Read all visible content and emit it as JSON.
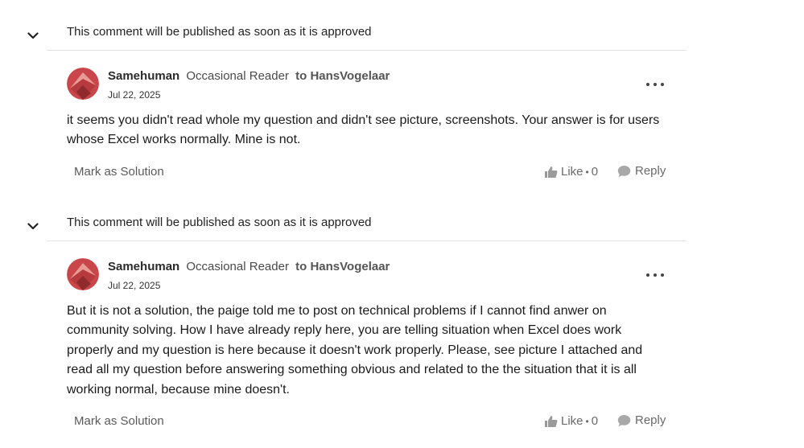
{
  "comments": [
    {
      "pending_note": "This comment will be published as soon as it is approved",
      "author": "Samehuman",
      "rank": "Occasional Reader",
      "to_word": "to",
      "to_user": "HansVogelaar",
      "date": "Jul 22, 2025",
      "body": "it seems you didn't read whole my question and didn't see picture, screenshots. Your answer is for users whose Excel works normally. Mine is not.",
      "mark_solution": "Mark as Solution",
      "like_label": "Like",
      "like_sep": "•",
      "like_count": "0",
      "reply_label": "Reply"
    },
    {
      "pending_note": "This comment will be published as soon as it is approved",
      "author": "Samehuman",
      "rank": "Occasional Reader",
      "to_word": "to",
      "to_user": "HansVogelaar",
      "date": "Jul 22, 2025",
      "body": "But it is not a solution, the paige told me to post on technical problems if I cannot find anwer on community solving. How I have already reply here, you are telling situation when Excel does work properly and my question is here because it doesn't work properly. Please, see picture I attached and read all my question before answering something obvious and related to the the situation that it is all working normal, because mine doesn't.",
      "mark_solution": "Mark as Solution",
      "like_label": "Like",
      "like_sep": "•",
      "like_count": "0",
      "reply_label": "Reply"
    }
  ],
  "icons": {
    "collapse": "chevron-down-icon",
    "more": "more-options-icon",
    "like": "thumbs-up-icon",
    "reply": "speech-bubble-icon"
  },
  "colors": {
    "avatar_primary": "#c9474a",
    "avatar_light": "#e89a95",
    "avatar_dark": "#8f2a2d",
    "divider": "#e3e3e3"
  }
}
